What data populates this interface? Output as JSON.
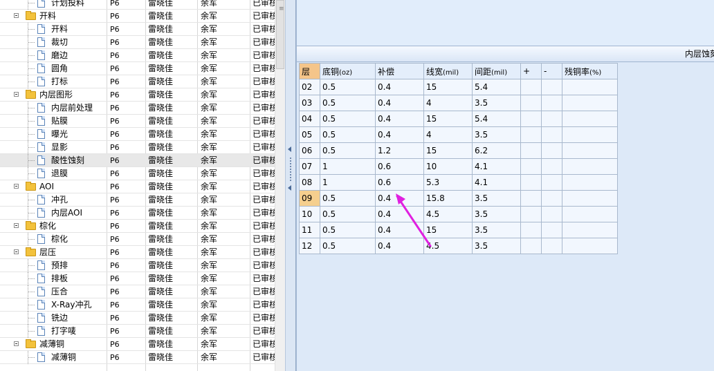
{
  "tree": {
    "rows": [
      {
        "kind": "child",
        "label": "计划投料",
        "version": "P6",
        "person1": "雷晓佳",
        "person2": "余军",
        "status": "已审核"
      },
      {
        "kind": "group",
        "label": "开料",
        "version": "P6",
        "person1": "雷晓佳",
        "person2": "余军",
        "status": "已审核"
      },
      {
        "kind": "child",
        "label": "开料",
        "version": "P6",
        "person1": "雷晓佳",
        "person2": "余军",
        "status": "已审核"
      },
      {
        "kind": "child",
        "label": "裁切",
        "version": "P6",
        "person1": "雷晓佳",
        "person2": "余军",
        "status": "已审核"
      },
      {
        "kind": "child",
        "label": "磨边",
        "version": "P6",
        "person1": "雷晓佳",
        "person2": "余军",
        "status": "已审核"
      },
      {
        "kind": "child",
        "label": "圆角",
        "version": "P6",
        "person1": "雷晓佳",
        "person2": "余军",
        "status": "已审核"
      },
      {
        "kind": "child",
        "label": "打标",
        "version": "P6",
        "person1": "雷晓佳",
        "person2": "余军",
        "status": "已审核"
      },
      {
        "kind": "group",
        "label": "内层图形",
        "version": "P6",
        "person1": "雷晓佳",
        "person2": "余军",
        "status": "已审核"
      },
      {
        "kind": "child",
        "label": "内层前处理",
        "version": "P6",
        "person1": "雷晓佳",
        "person2": "余军",
        "status": "已审核"
      },
      {
        "kind": "child",
        "label": "贴膜",
        "version": "P6",
        "person1": "雷晓佳",
        "person2": "余军",
        "status": "已审核"
      },
      {
        "kind": "child",
        "label": "曝光",
        "version": "P6",
        "person1": "雷晓佳",
        "person2": "余军",
        "status": "已审核"
      },
      {
        "kind": "child",
        "label": "显影",
        "version": "P6",
        "person1": "雷晓佳",
        "person2": "余军",
        "status": "已审核"
      },
      {
        "kind": "child",
        "label": "酸性蚀刻",
        "version": "P6",
        "person1": "雷晓佳",
        "person2": "余军",
        "status": "已审核",
        "selected": true
      },
      {
        "kind": "child",
        "label": "退膜",
        "version": "P6",
        "person1": "雷晓佳",
        "person2": "余军",
        "status": "已审核"
      },
      {
        "kind": "group",
        "label": "AOI",
        "version": "P6",
        "person1": "雷晓佳",
        "person2": "余军",
        "status": "已审核"
      },
      {
        "kind": "child",
        "label": "冲孔",
        "version": "P6",
        "person1": "雷晓佳",
        "person2": "余军",
        "status": "已审核"
      },
      {
        "kind": "child",
        "label": "内层AOI",
        "version": "P6",
        "person1": "雷晓佳",
        "person2": "余军",
        "status": "已审核"
      },
      {
        "kind": "group",
        "label": "棕化",
        "version": "P6",
        "person1": "雷晓佳",
        "person2": "余军",
        "status": "已审核"
      },
      {
        "kind": "child",
        "label": "棕化",
        "version": "P6",
        "person1": "雷晓佳",
        "person2": "余军",
        "status": "已审核"
      },
      {
        "kind": "group",
        "label": "层压",
        "version": "P6",
        "person1": "雷晓佳",
        "person2": "余军",
        "status": "已审核"
      },
      {
        "kind": "child",
        "label": "预排",
        "version": "P6",
        "person1": "雷晓佳",
        "person2": "余军",
        "status": "已审核"
      },
      {
        "kind": "child",
        "label": "排板",
        "version": "P6",
        "person1": "雷晓佳",
        "person2": "余军",
        "status": "已审核"
      },
      {
        "kind": "child",
        "label": "压合",
        "version": "P6",
        "person1": "雷晓佳",
        "person2": "余军",
        "status": "已审核"
      },
      {
        "kind": "child",
        "label": "X-Ray冲孔",
        "version": "P6",
        "person1": "雷晓佳",
        "person2": "余军",
        "status": "已审核"
      },
      {
        "kind": "child",
        "label": "铣边",
        "version": "P6",
        "person1": "雷晓佳",
        "person2": "余军",
        "status": "已审核"
      },
      {
        "kind": "child",
        "label": "打字唛",
        "version": "P6",
        "person1": "雷晓佳",
        "person2": "余军",
        "status": "已审核"
      },
      {
        "kind": "group",
        "label": "减薄铜",
        "version": "P6",
        "person1": "雷晓佳",
        "person2": "余军",
        "status": "已审核"
      },
      {
        "kind": "child",
        "label": "减薄铜",
        "version": "P6",
        "person1": "雷晓佳",
        "person2": "余军",
        "status": "已审核"
      }
    ]
  },
  "panel": {
    "title": "内层蚀刻",
    "columns": [
      {
        "label": "层",
        "unit": ""
      },
      {
        "label": "底铜",
        "unit": "(oz)"
      },
      {
        "label": "补偿",
        "unit": ""
      },
      {
        "label": "线宽",
        "unit": "(mil)"
      },
      {
        "label": "间距",
        "unit": "(mil)"
      },
      {
        "label": "+",
        "unit": ""
      },
      {
        "label": "-",
        "unit": ""
      },
      {
        "label": "残铜率",
        "unit": "(%)"
      }
    ],
    "rows": [
      {
        "layer": "02",
        "base_copper": "0.5",
        "compensation": "0.4",
        "line_width": "15",
        "spacing": "5.4",
        "plus": "",
        "minus": "",
        "residual": ""
      },
      {
        "layer": "03",
        "base_copper": "0.5",
        "compensation": "0.4",
        "line_width": "4",
        "spacing": "3.5",
        "plus": "",
        "minus": "",
        "residual": ""
      },
      {
        "layer": "04",
        "base_copper": "0.5",
        "compensation": "0.4",
        "line_width": "15",
        "spacing": "5.4",
        "plus": "",
        "minus": "",
        "residual": ""
      },
      {
        "layer": "05",
        "base_copper": "0.5",
        "compensation": "0.4",
        "line_width": "4",
        "spacing": "3.5",
        "plus": "",
        "minus": "",
        "residual": ""
      },
      {
        "layer": "06",
        "base_copper": "0.5",
        "compensation": "1.2",
        "line_width": "15",
        "spacing": "6.2",
        "plus": "",
        "minus": "",
        "residual": ""
      },
      {
        "layer": "07",
        "base_copper": "1",
        "compensation": "0.6",
        "line_width": "10",
        "spacing": "4.1",
        "plus": "",
        "minus": "",
        "residual": ""
      },
      {
        "layer": "08",
        "base_copper": "1",
        "compensation": "0.6",
        "line_width": "5.3",
        "spacing": "4.1",
        "plus": "",
        "minus": "",
        "residual": ""
      },
      {
        "layer": "09",
        "base_copper": "0.5",
        "compensation": "0.4",
        "line_width": "15.8",
        "spacing": "3.5",
        "plus": "",
        "minus": "",
        "residual": "",
        "current": true
      },
      {
        "layer": "10",
        "base_copper": "0.5",
        "compensation": "0.4",
        "line_width": "4.5",
        "spacing": "3.5",
        "plus": "",
        "minus": "",
        "residual": ""
      },
      {
        "layer": "11",
        "base_copper": "0.5",
        "compensation": "0.4",
        "line_width": "15",
        "spacing": "3.5",
        "plus": "",
        "minus": "",
        "residual": ""
      },
      {
        "layer": "12",
        "base_copper": "0.5",
        "compensation": "0.4",
        "line_width": "4.5",
        "spacing": "3.5",
        "plus": "",
        "minus": "",
        "residual": ""
      }
    ]
  },
  "annotation": {
    "color": "#e020e0"
  }
}
